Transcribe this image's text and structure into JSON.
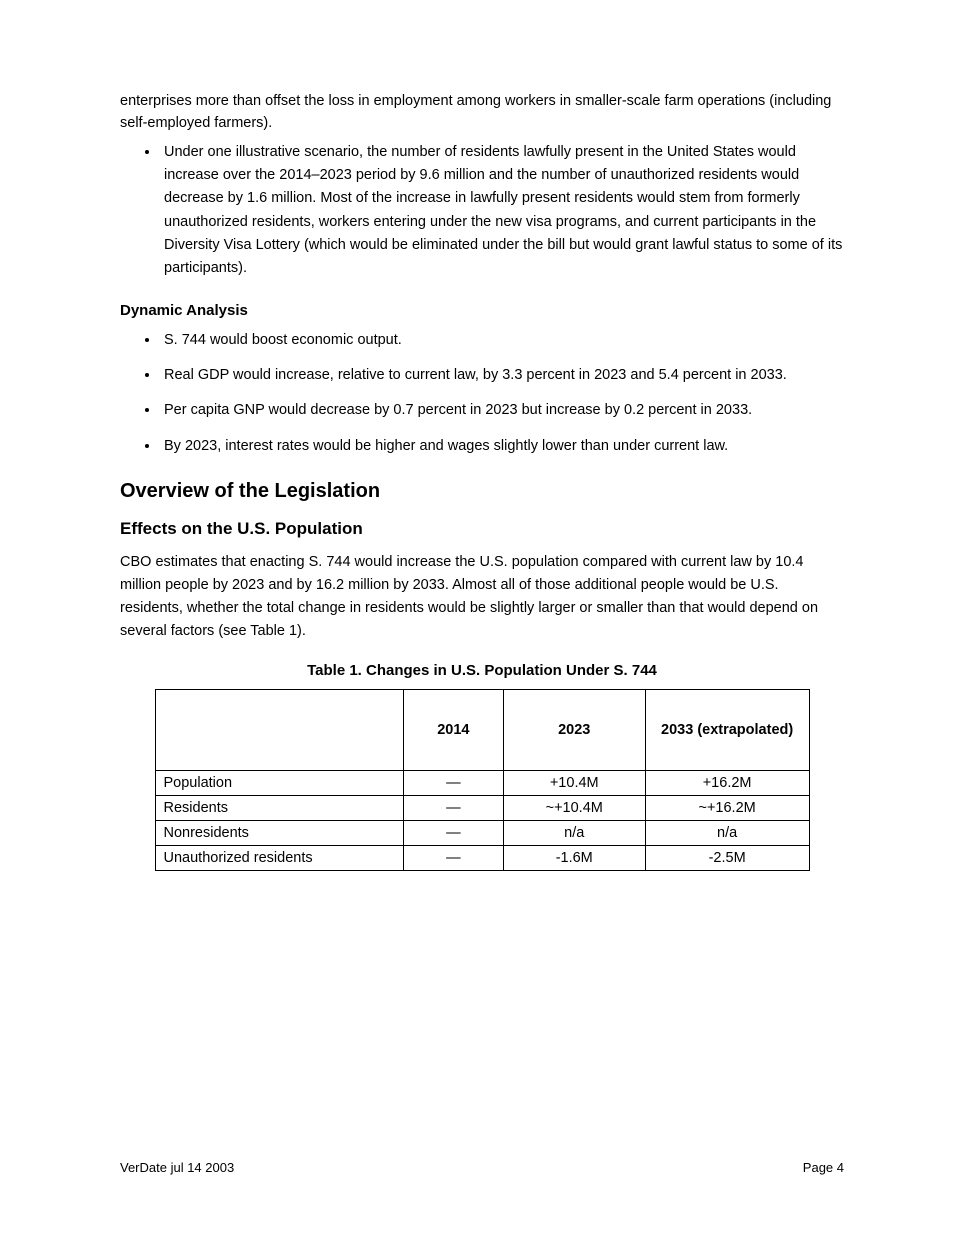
{
  "intro": "enterprises more than offset the loss in employment among workers in smaller-scale farm operations (including self-employed farmers).",
  "bullets_top": [
    "Under one illustrative scenario, the number of residents lawfully present in the United States would increase over the 2014–2023 period by 9.6 million and the number of unauthorized residents would decrease by 1.6 million. Most of the increase in lawfully present residents would stem from formerly unauthorized residents, workers entering under the new visa programs, and current participants in the Diversity Visa Lottery (which would be eliminated under the bill but would grant lawful status to some of its participants)."
  ],
  "h_dynamic": "Dynamic Analysis",
  "bullets_dynamic": [
    "S. 744 would boost economic output.",
    "Real GDP would increase, relative to current law, by 3.3 percent in 2023 and 5.4 percent in 2033.",
    "Per capita GNP would decrease by 0.7 percent in 2023 but increase by 0.2 percent in 2033.",
    "By 2023, interest rates would be higher and wages slightly lower than under current law."
  ],
  "h_overview": "Overview of the Legislation",
  "h_effects": "Effects on the U.S. Population",
  "body_para": "CBO estimates that enacting S. 744 would increase the U.S. population compared with current law by 10.4 million people by 2023 and by 16.2 million by 2033. Almost all of those additional people would be U.S. residents, whether the total change in residents would be slightly larger or smaller than that would depend on several factors (see Table 1).",
  "table_title": "Table 1. Changes in U.S. Population Under S. 744",
  "table_headers": [
    "",
    "2014",
    "2023",
    "2033 (extrapolated)"
  ],
  "table_rows": [
    {
      "label": "Population",
      "c1": "—",
      "c2": "+10.4M",
      "c3": "+16.2M"
    },
    {
      "label": "Residents",
      "c1": "—",
      "c2": "~+10.4M",
      "c3": "~+16.2M"
    },
    {
      "label": "Nonresidents",
      "c1": "—",
      "c2": "n/a",
      "c3": "n/a"
    },
    {
      "label": "Unauthorized residents",
      "c1": "—",
      "c2": "-1.6M",
      "c3": "-2.5M"
    }
  ],
  "footer_left": "VerDate jul 14 2003",
  "footer_right": "Page 4"
}
